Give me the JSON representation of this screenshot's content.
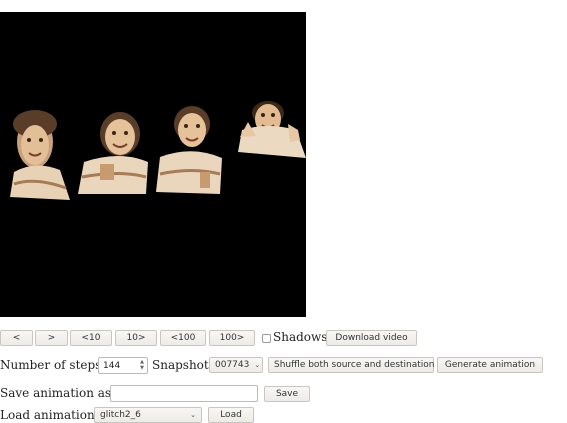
{
  "nav": {
    "prev": "<",
    "next": ">",
    "back10": "<10",
    "fwd10": "10>",
    "back100": "<100",
    "fwd100": "100>"
  },
  "shadows_label": "Shadows",
  "download_label": "Download video",
  "steps": {
    "label": "Number of steps:",
    "value": "144"
  },
  "snapshot": {
    "label": "Snapshot:",
    "value": "007743"
  },
  "shuffle": {
    "value": "Shuffle both source and destination"
  },
  "generate_label": "Generate animation",
  "save": {
    "label": "Save animation as:",
    "value": "",
    "button": "Save"
  },
  "load": {
    "label": "Load animation:",
    "value": "glitch2_6",
    "button": "Load"
  }
}
